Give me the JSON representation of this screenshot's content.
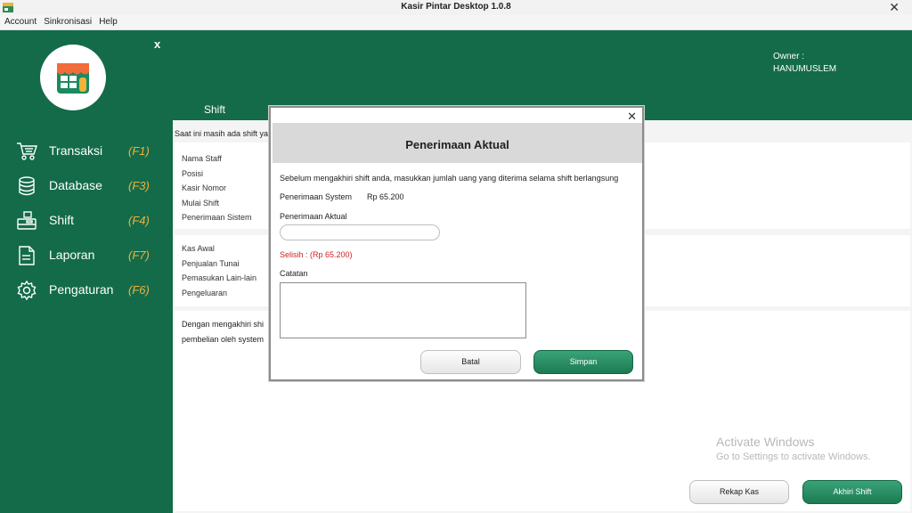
{
  "window": {
    "title": "Kasir Pintar Desktop 1.0.8",
    "close": "✕"
  },
  "menu": [
    "Account",
    "Sinkronisasi",
    "Help"
  ],
  "sidebar": {
    "collapse": "x",
    "items": [
      {
        "label": "Transaksi",
        "key": "(F1)",
        "icon": "cart-icon"
      },
      {
        "label": "Database",
        "key": "(F3)",
        "icon": "database-icon"
      },
      {
        "label": "Shift",
        "key": "(F4)",
        "icon": "register-icon"
      },
      {
        "label": "Laporan",
        "key": "(F7)",
        "icon": "report-icon"
      },
      {
        "label": "Pengaturan",
        "key": "(F6)",
        "icon": "gear-icon"
      }
    ]
  },
  "header": {
    "owner_label": "Owner :",
    "owner_name": "HANUMUSLEM",
    "tab": "Shift"
  },
  "main": {
    "notice": "Saat ini masih ada shift ya",
    "panel1": [
      "Nama Staff",
      "Posisi",
      "Kasir Nomor",
      "Mulai Shift",
      "Penerimaan Sistem"
    ],
    "panel2": [
      "Kas Awal",
      "Penjualan Tunai",
      "Pemasukan Lain-lain",
      "Pengeluaran"
    ],
    "panel3": [
      "Dengan mengakhiri shi",
      "pembelian oleh system"
    ],
    "watermark_title": "Activate Windows",
    "watermark_sub": "Go to Settings to activate Windows.",
    "rekap_button": "Rekap Kas",
    "akhiri_button": "Akhiri Shift"
  },
  "dialog": {
    "title": "Penerimaan Aktual",
    "close": "✕",
    "instruction": "Sebelum mengakhiri shift anda, masukkan jumlah uang yang diterima selama shift berlangsung",
    "system_label": "Penerimaan System",
    "system_value": "Rp 65.200",
    "aktual_label": "Penerimaan Aktual",
    "aktual_value": "",
    "selisih": "Selisih : (Rp 65.200)",
    "catatan_label": "Catatan",
    "catatan_value": "",
    "batal": "Batal",
    "simpan": "Simpan"
  },
  "colors": {
    "primary": "#136b4a",
    "accent": "#f0b23a",
    "danger": "#d42020"
  }
}
